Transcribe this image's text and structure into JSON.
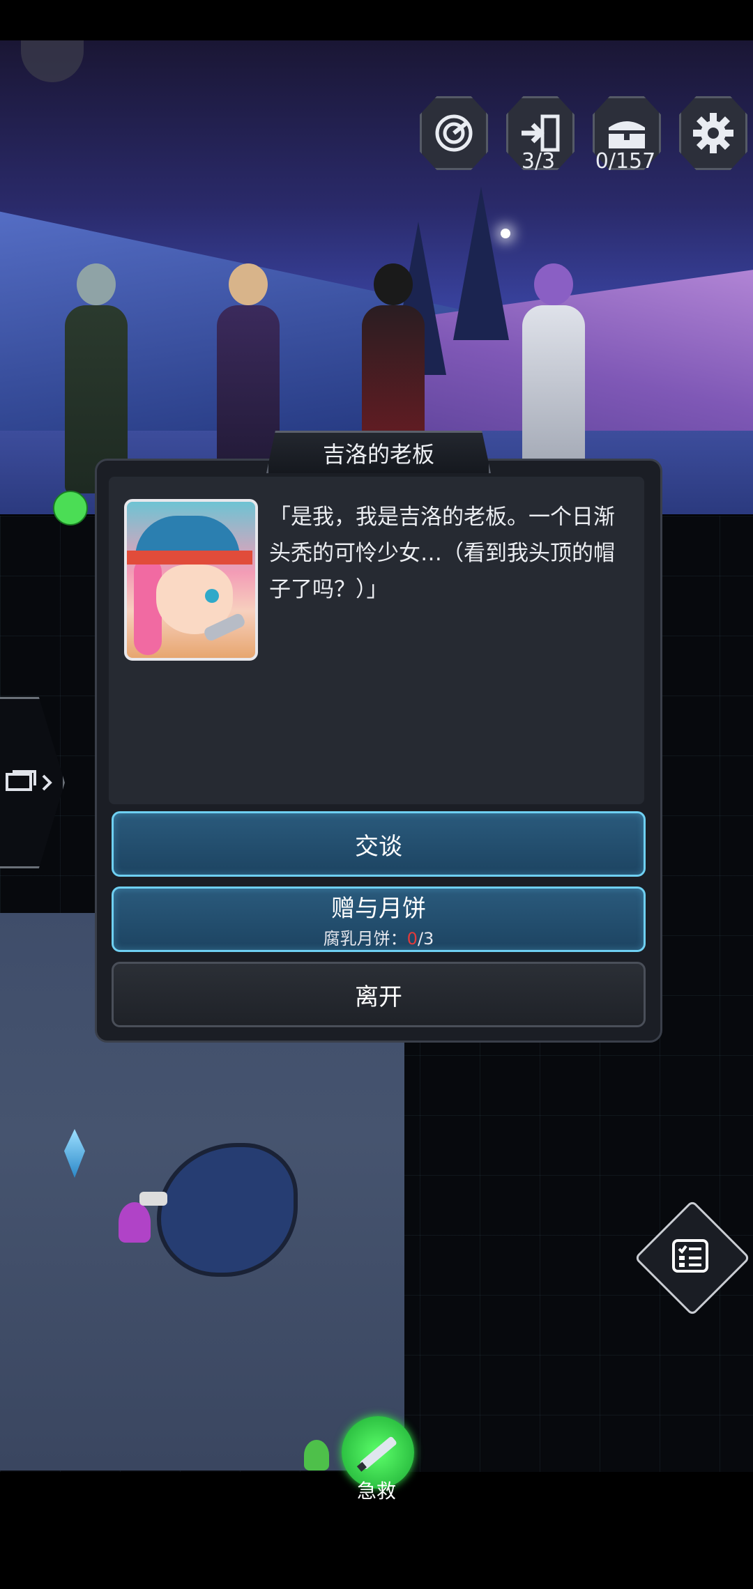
{
  "top_bar": {
    "radar_icon": "radar-icon",
    "exit_icon": "exit-door-icon",
    "exit_count": "3/3",
    "chest_icon": "treasure-chest-icon",
    "chest_count": "0/157",
    "settings_icon": "gear-icon"
  },
  "dialog": {
    "title": "吉洛的老板",
    "text": "「是我，我是吉洛的老板。一个日渐头秃的可怜少女…（看到我头顶的帽子了吗？）」",
    "talk_button": "交谈",
    "gift_button": "赠与月饼",
    "gift_sub_label": "腐乳月饼：",
    "gift_have": "0",
    "gift_need": "/3",
    "leave_button": "离开"
  },
  "map": {
    "rescue_label": "急救",
    "quest_list_icon": "checklist-icon",
    "chat_icon": "chat-icon"
  },
  "colors": {
    "accent_cyan": "#6fd0f2",
    "button_blue": "#1d4462",
    "count_red": "#e23b3b"
  }
}
